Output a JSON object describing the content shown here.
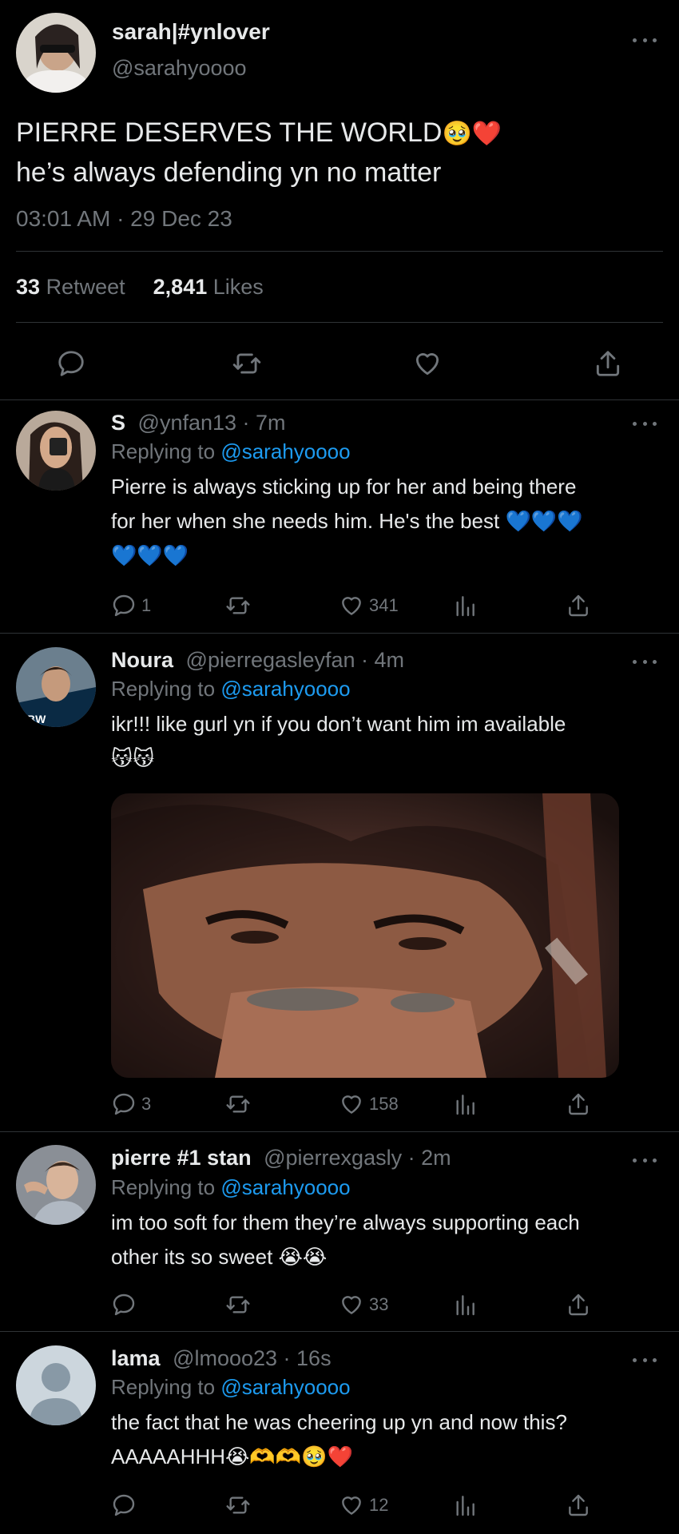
{
  "main_tweet": {
    "display_name": "sarah|#ynlover",
    "handle": "@sarahyoooo",
    "text_line1": "PIERRE DESERVES THE WORLD",
    "text_line1_emoji": "🥹❤️",
    "text_line2": "he’s always defending yn no matter",
    "timestamp": "03:01 AM · 29 Dec 23",
    "retweet_count": "33",
    "retweet_label": "Retweet",
    "likes_count": "2,841",
    "likes_label": "Likes"
  },
  "replies": [
    {
      "display_name": "S",
      "handle_time": "@ynfan13 · 7m",
      "replying_label": "Replying to",
      "replying_handle": "@sarahyoooo",
      "text_line1": "Pierre is always sticking up for her and being there",
      "text_line2": "for her when she needs him. He's the best 💙💙💙",
      "text_line3": "💙💙💙",
      "reply_count": "1",
      "retweet_count": "",
      "like_count": "341"
    },
    {
      "display_name": "Noura",
      "handle_time": "@pierregasleyfan · 4m",
      "replying_label": "Replying to",
      "replying_handle": "@sarahyoooo",
      "text_line1": "ikr!!! like gurl yn if you don’t want him im available",
      "text_line2": "😽😽",
      "reply_count": "3",
      "retweet_count": "",
      "like_count": "158"
    },
    {
      "display_name": "pierre #1 stan",
      "handle_time": "@pierrexgasly · 2m",
      "replying_label": "Replying to",
      "replying_handle": "@sarahyoooo",
      "text_line1": "im too soft for them they’re always supporting each",
      "text_line2": "other its so sweet 😭😭",
      "reply_count": "",
      "retweet_count": "",
      "like_count": "33"
    },
    {
      "display_name": "lama",
      "handle_time": "@lmooo23 · 16s",
      "replying_label": "Replying to",
      "replying_handle": "@sarahyoooo",
      "text_line1": "the fact that he was cheering up yn and now this?",
      "text_line2": "AAAAAHHH😭🫶🫶🥹❤️",
      "reply_count": "",
      "retweet_count": "",
      "like_count": "12"
    }
  ],
  "colors": {
    "background": "#000000",
    "text": "#e7e9ea",
    "muted": "#71767b",
    "link": "#1d9bf0",
    "divider": "#2f3336"
  }
}
